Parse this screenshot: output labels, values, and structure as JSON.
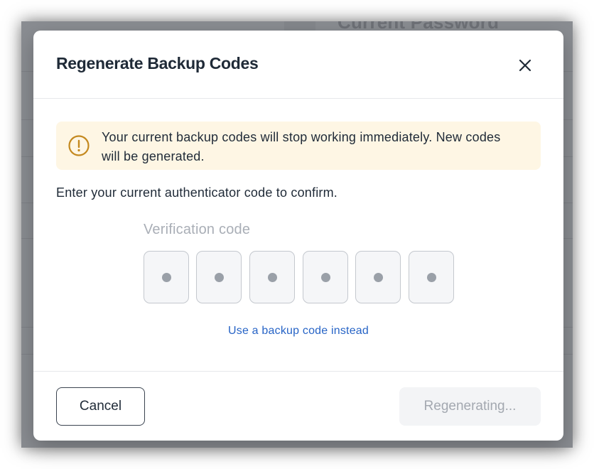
{
  "background": {
    "heading": "Current Password"
  },
  "modal": {
    "title": "Regenerate Backup Codes",
    "close_icon": "close-icon",
    "warning": {
      "icon": "alert-circle-icon",
      "text": "Your current backup codes will stop working immediately. New codes will be generated.",
      "color": "#fef6e4",
      "icon_color": "#c4891f"
    },
    "instruction": "Enter your current authenticator code to confirm.",
    "verification": {
      "label": "Verification code",
      "digit_count": 6
    },
    "backup_link": "Use a backup code instead",
    "footer": {
      "cancel_label": "Cancel",
      "regenerate_label": "Regenerating..."
    }
  },
  "colors": {
    "link": "#2764c6",
    "disabled_text": "#a3a8b0"
  }
}
